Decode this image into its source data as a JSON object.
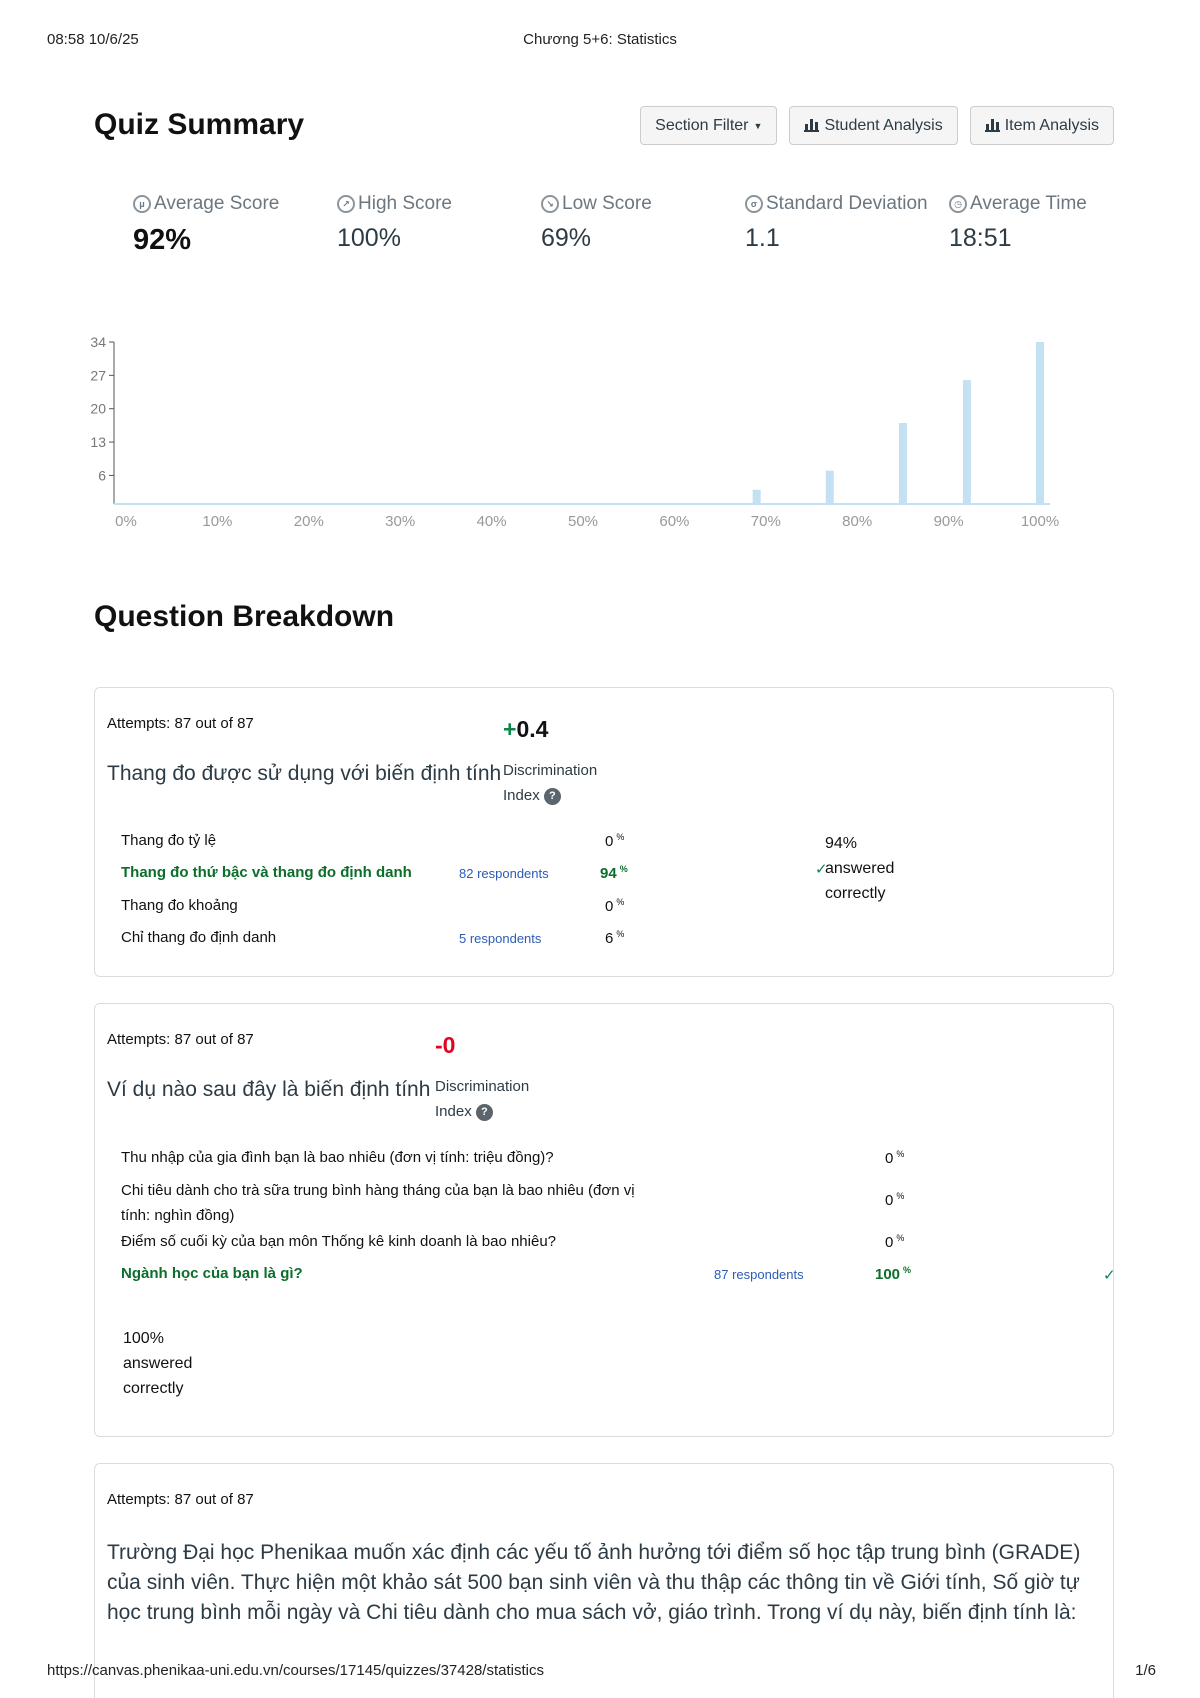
{
  "print_header": {
    "datetime": "08:58 10/6/25",
    "doc_title": "Chương 5+6: Statistics"
  },
  "print_footer": {
    "url": "https://canvas.phenikaa-uni.edu.vn/courses/17145/quizzes/37428/statistics",
    "page": "1/6"
  },
  "page_title": "Quiz Summary",
  "toolbar": {
    "section_filter": "Section Filter",
    "student_analysis": "Student Analysis",
    "item_analysis": "Item Analysis"
  },
  "stats": {
    "average_score": {
      "label": "Average Score",
      "value": "92%"
    },
    "high_score": {
      "label": "High Score",
      "value": "100%"
    },
    "low_score": {
      "label": "Low Score",
      "value": "69%"
    },
    "std_dev": {
      "label": "Standard Deviation",
      "value": "1.1"
    },
    "average_time": {
      "label": "Average Time",
      "value": "18:51"
    }
  },
  "chart_data": {
    "type": "bar",
    "title": "",
    "xlabel": "",
    "ylabel": "",
    "x_ticks": [
      "0%",
      "10%",
      "20%",
      "30%",
      "40%",
      "50%",
      "60%",
      "70%",
      "80%",
      "90%",
      "100%"
    ],
    "y_ticks": [
      "6",
      "13",
      "20",
      "27",
      "34"
    ],
    "ylim": [
      0,
      34
    ],
    "x": [
      69,
      77,
      85,
      92,
      100
    ],
    "values": [
      3,
      7,
      17,
      26,
      34
    ],
    "bar_color": "#c4e0f3",
    "grid": false
  },
  "section_title": "Question Breakdown",
  "questions": [
    {
      "attempts": "Attempts: 87 out of 87",
      "text": "Thang đo được sử dụng với biến định tính",
      "disc_sign": "+",
      "disc_value": "0.4",
      "disc_label_1": "Discrimination",
      "disc_label_2": "Index",
      "answers": [
        {
          "text": "Thang đo tỷ lệ",
          "respondents": "",
          "pct": "0",
          "correct": false
        },
        {
          "text": "Thang đo thứ bậc và thang đo định danh",
          "respondents": "82 respondents",
          "pct": "94",
          "correct": true
        },
        {
          "text": "Thang đo khoảng",
          "respondents": "",
          "pct": "0",
          "correct": false
        },
        {
          "text": "Chỉ thang đo định danh",
          "respondents": "5 respondents",
          "pct": "6",
          "correct": false
        }
      ],
      "summary_pct": "94%",
      "summary_l2": "answered",
      "summary_l3": "correctly"
    },
    {
      "attempts": "Attempts: 87 out of 87",
      "text": "Ví dụ nào sau đây là biến định tính",
      "disc_value": "-0",
      "disc_label_1": "Discrimination",
      "disc_label_2": "Index",
      "answers": [
        {
          "text": "Thu nhập của gia đình bạn là bao nhiêu (đơn vị tính: triệu đồng)?",
          "respondents": "",
          "pct": "0",
          "correct": false
        },
        {
          "text_l1": "Chi tiêu dành cho trà sữa trung bình hàng tháng của bạn là bao nhiêu (đơn vị",
          "text_l2": "tính: nghìn đồng)",
          "respondents": "",
          "pct": "0",
          "correct": false
        },
        {
          "text": "Điểm số cuối kỳ của bạn môn Thống kê kinh doanh là bao nhiêu?",
          "respondents": "",
          "pct": "0",
          "correct": false
        },
        {
          "text": "Ngành học của bạn là gì?",
          "respondents": "87 respondents",
          "pct": "100",
          "correct": true
        }
      ],
      "summary_pct": "100%",
      "summary_l2": "answered",
      "summary_l3": "correctly"
    },
    {
      "attempts": "Attempts: 87 out of 87",
      "text": "Trường Đại học Phenikaa muốn xác định các yếu tố ảnh hưởng tới điểm số học tập trung bình (GRADE) của sinh viên. Thực hiện một khảo sát 500 bạn sinh viên và thu thập các thông tin về Giới tính, Số giờ tự học trung bình mỗi ngày và Chi tiêu dành cho mua sách vở, giáo trình. Trong ví dụ này, biến định tính là:"
    }
  ]
}
